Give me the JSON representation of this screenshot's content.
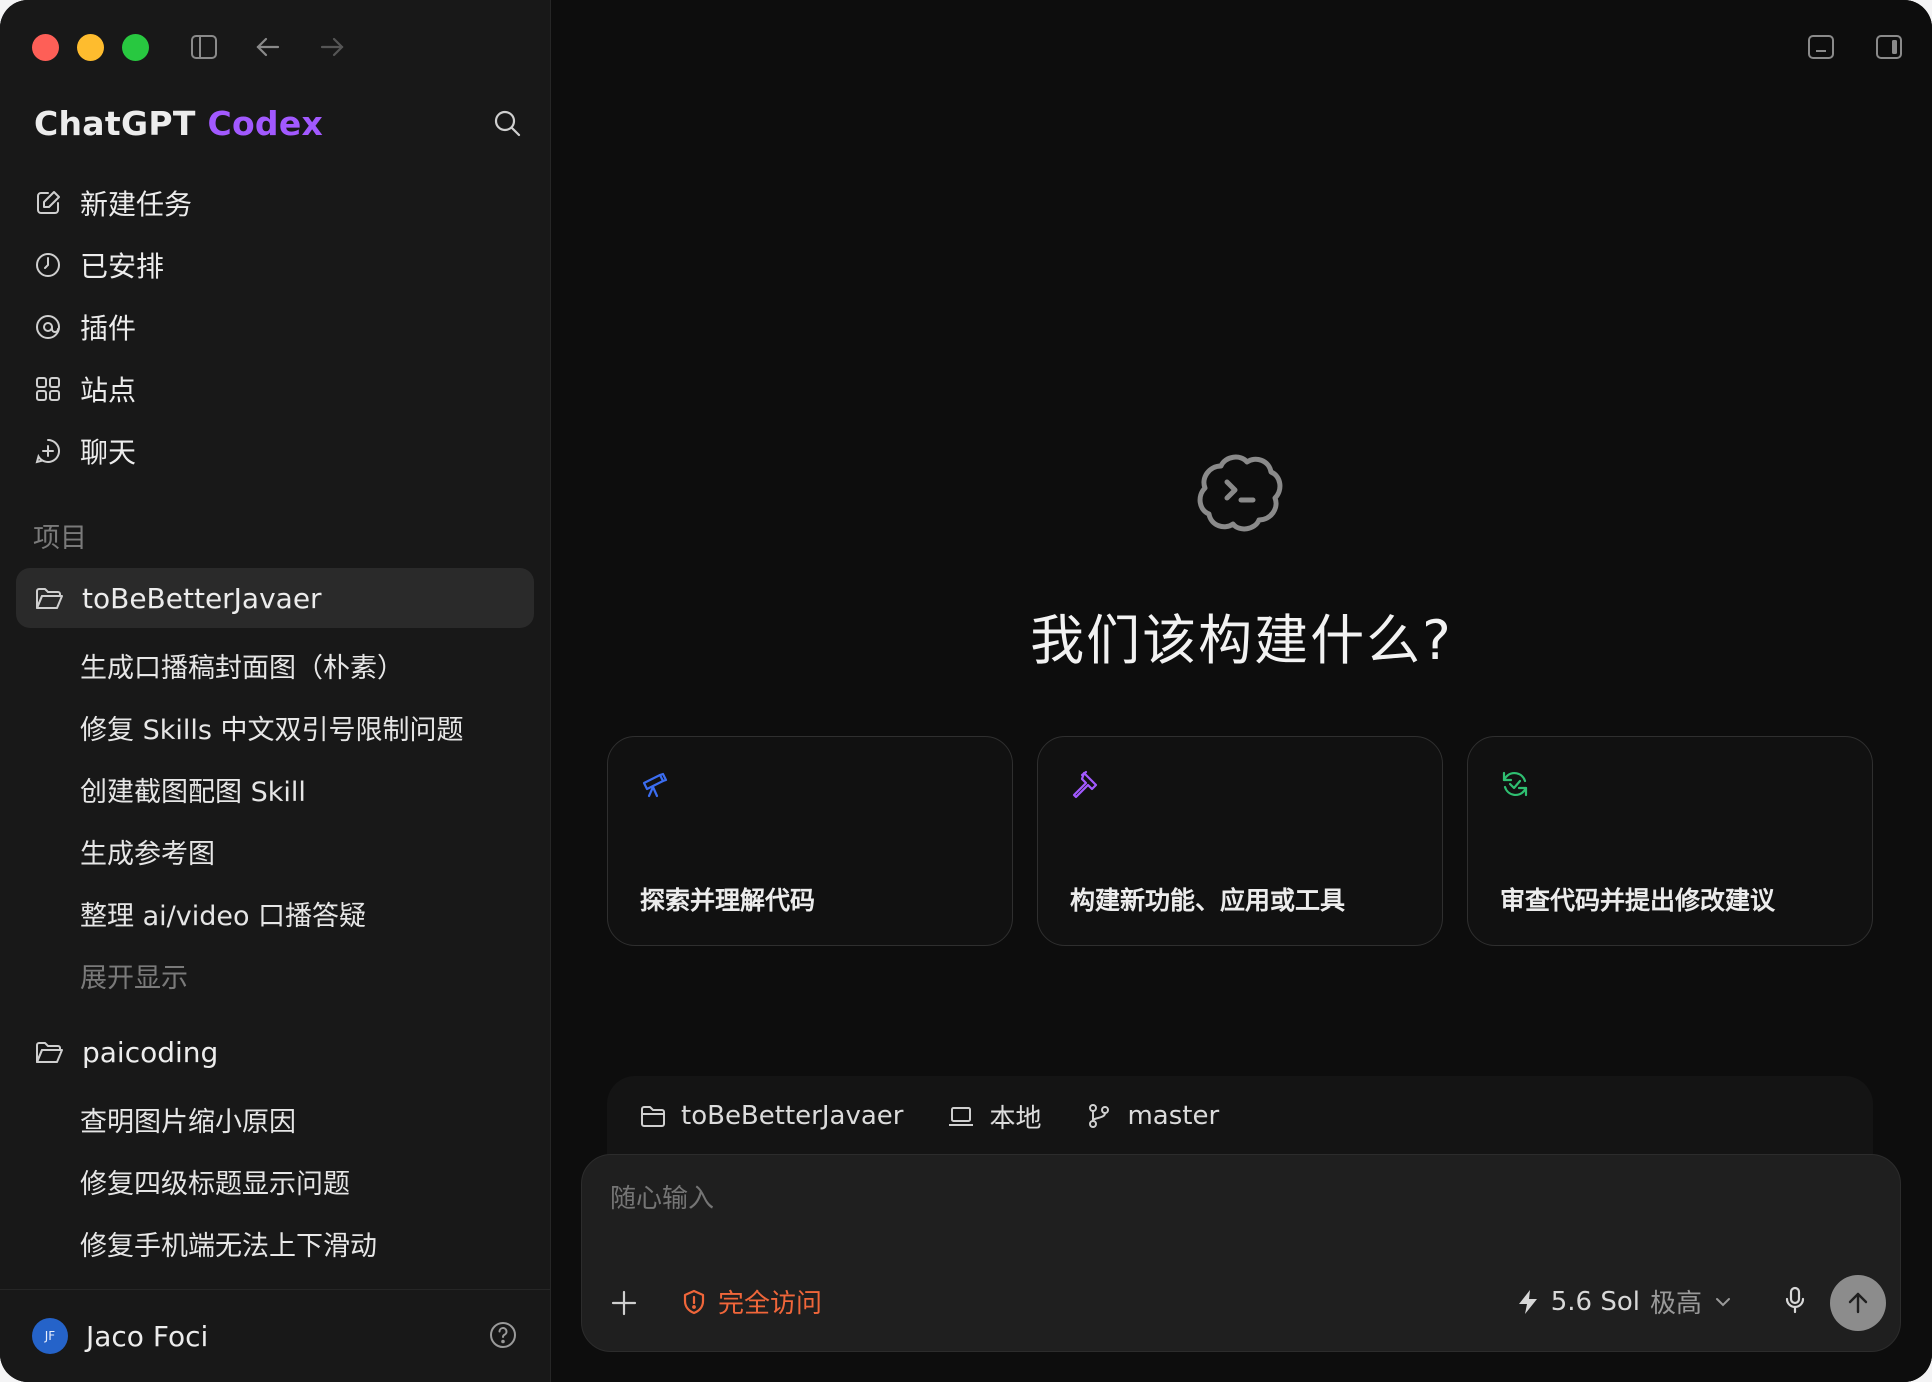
{
  "window": {
    "brand_primary": "ChatGPT",
    "brand_secondary": "Codex"
  },
  "sidebar": {
    "nav": [
      {
        "label": "新建任务",
        "icon": "edit-icon"
      },
      {
        "label": "已安排",
        "icon": "clock-icon"
      },
      {
        "label": "插件",
        "icon": "plugin-icon"
      },
      {
        "label": "站点",
        "icon": "grid-icon"
      },
      {
        "label": "聊天",
        "icon": "chat-plus-icon"
      }
    ],
    "section_label": "项目",
    "projects": [
      {
        "name": "toBeBetterJavaer",
        "active": true,
        "threads": [
          "生成口播稿封面图（朴素）",
          "修复 Skills 中文双引号限制问题",
          "创建截图配图 Skill",
          "生成参考图",
          "整理 ai/video 口播答疑"
        ],
        "expand_label": "展开显示"
      },
      {
        "name": "paicoding",
        "active": false,
        "threads": [
          "查明图片缩小原因",
          "修复四级标题显示问题",
          "修复手机端无法上下滑动"
        ]
      }
    ],
    "user": {
      "initials": "JF",
      "name": "Jaco Foci"
    }
  },
  "main": {
    "headline": "我们该构建什么?",
    "cards": [
      {
        "label": "探索并理解代码",
        "icon": "telescope-icon",
        "color": "#3b6df0"
      },
      {
        "label": "构建新功能、应用或工具",
        "icon": "hammer-icon",
        "color": "#a259ff"
      },
      {
        "label": "审查代码并提出修改建议",
        "icon": "review-refresh-icon",
        "color": "#2fbf71"
      }
    ],
    "context": {
      "project": "toBeBetterJavaer",
      "environment": "本地",
      "branch": "master"
    },
    "composer": {
      "placeholder": "随心输入",
      "access_label": "完全访问",
      "model_name": "5.6 Sol",
      "model_effort": "极高"
    }
  },
  "colors": {
    "accent_purple": "#a259ff",
    "warning_orange": "#f0663a",
    "close": "#fe5f57",
    "minimize": "#febc2e",
    "maximize": "#28c840"
  }
}
